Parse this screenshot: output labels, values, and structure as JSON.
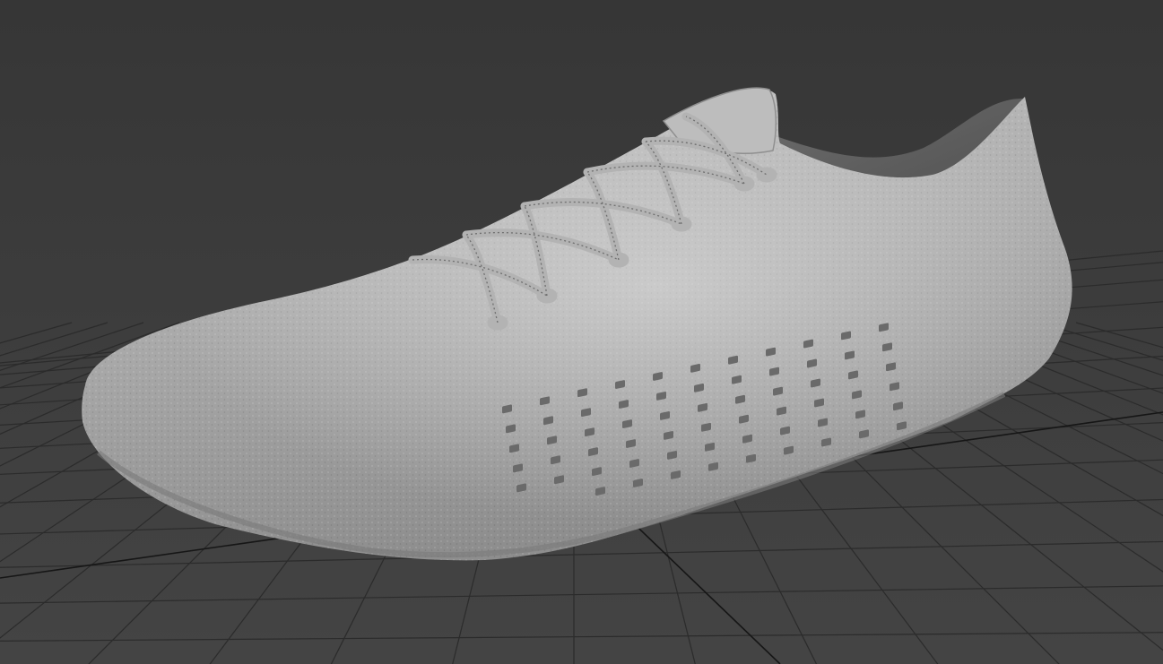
{
  "viewport": {
    "view": "perspective",
    "shading": "default-shading",
    "grid_visible": true,
    "background_color": "#3c3c3c",
    "grid_color": "#2a2a2a",
    "grid_axis_color": "#1a1a1a"
  },
  "model": {
    "kind": "shoe-upper",
    "material_color": "#a9a9a9",
    "surface": "textured-knit",
    "laces": true,
    "perforations": true
  }
}
